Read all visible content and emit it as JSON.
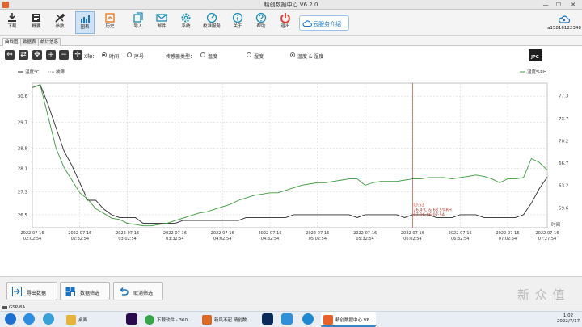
{
  "window": {
    "title": "精创数据中心 V6.2.0",
    "minimize": "—",
    "maximize": "☐",
    "close": "✕"
  },
  "toolbar": {
    "items": [
      {
        "label": "下载"
      },
      {
        "label": "概要"
      },
      {
        "label": "参数"
      },
      {
        "label": "图表"
      },
      {
        "label": "历史"
      },
      {
        "label": "导入"
      },
      {
        "label": "邮件"
      },
      {
        "label": "系统"
      },
      {
        "label": "校准服务"
      },
      {
        "label": "关于"
      },
      {
        "label": "帮助"
      },
      {
        "label": "退出"
      }
    ],
    "cloud_label": "云服务介绍",
    "account_label": "a15816122348"
  },
  "subtabs": [
    {
      "label": "曲线图"
    },
    {
      "label": "数据表"
    },
    {
      "label": "统计信息"
    }
  ],
  "controls": {
    "x_axis_label": "X轴：",
    "x_axis_options": [
      {
        "label": "时间",
        "checked": true
      },
      {
        "label": "序号",
        "checked": false
      }
    ],
    "sensor_label": "传感器类型：",
    "sensor_options": [
      {
        "label": "温度",
        "checked": false
      },
      {
        "label": "湿度",
        "checked": false
      },
      {
        "label": "温度 & 湿度",
        "checked": true
      }
    ],
    "export_jpg": "JPG"
  },
  "chart_data": {
    "type": "line",
    "legend": {
      "left": [
        "温度°C",
        "故障"
      ],
      "right": [
        "湿度%RH"
      ]
    },
    "x_label": "时间",
    "x_ticks": [
      "2022-07-16\n02:02:54",
      "2022-07-16\n02:32:54",
      "2022-07-16\n03:02:54",
      "2022-07-16\n03:32:54",
      "2022-07-16\n04:02:54",
      "2022-07-16\n04:32:54",
      "2022-07-16\n05:02:54",
      "2022-07-16\n05:32:54",
      "2022-07-16\n06:02:54",
      "2022-07-16\n06:32:54",
      "2022-07-16\n07:02:54",
      "2022-07-16\n07:27:54"
    ],
    "y_left": {
      "ticks": [
        "30.6",
        "29.7",
        "28.8",
        "28.1",
        "27.3",
        "26.5"
      ],
      "values": [
        30.6,
        29.7,
        28.8,
        28.1,
        27.3,
        26.5
      ]
    },
    "y_right": {
      "ticks": [
        "77.3",
        "73.7",
        "70.2",
        "66.7",
        "63.2",
        "59.6"
      ],
      "values": [
        77.3,
        73.7,
        70.2,
        66.7,
        63.2,
        59.6
      ]
    },
    "x_minutes": [
      0,
      5,
      10,
      15,
      20,
      25,
      30,
      35,
      40,
      45,
      50,
      55,
      60,
      65,
      70,
      75,
      80,
      85,
      90,
      95,
      100,
      105,
      110,
      115,
      120,
      125,
      130,
      135,
      140,
      145,
      150,
      155,
      160,
      165,
      170,
      175,
      180,
      185,
      190,
      195,
      200,
      205,
      210,
      215,
      220,
      225,
      230,
      235,
      240,
      245,
      250,
      255,
      260,
      265,
      270,
      275,
      280,
      285,
      290,
      295,
      300,
      305,
      310,
      315,
      320,
      325
    ],
    "series": [
      {
        "name": "温度°C",
        "color": "#2b2b2b",
        "values": [
          30.9,
          31.0,
          30.3,
          29.5,
          28.7,
          28.2,
          27.6,
          27.0,
          27.0,
          26.7,
          26.5,
          26.4,
          26.4,
          26.4,
          26.2,
          26.2,
          26.2,
          26.2,
          26.2,
          26.3,
          26.3,
          26.3,
          26.3,
          26.3,
          26.3,
          26.3,
          26.3,
          26.4,
          26.4,
          26.4,
          26.4,
          26.4,
          26.4,
          26.5,
          26.5,
          26.5,
          26.5,
          26.5,
          26.5,
          26.5,
          26.5,
          26.4,
          26.5,
          26.5,
          26.5,
          26.5,
          26.5,
          26.4,
          26.5,
          26.5,
          26.5,
          26.4,
          26.4,
          26.4,
          26.5,
          26.5,
          26.5,
          26.4,
          26.4,
          26.4,
          26.4,
          26.4,
          26.5,
          26.9,
          27.4,
          27.8
        ]
      },
      {
        "name": "湿度%RH",
        "color": "#3c9a3c",
        "values": [
          78.6,
          79.0,
          74.0,
          69.0,
          66.0,
          64.0,
          62.0,
          61.0,
          59.5,
          58.8,
          58.0,
          57.8,
          57.2,
          57.0,
          56.8,
          56.8,
          57.0,
          57.2,
          57.6,
          58.0,
          58.4,
          58.8,
          59.0,
          59.4,
          59.8,
          60.2,
          60.8,
          61.2,
          61.6,
          61.8,
          62.0,
          62.0,
          62.4,
          62.8,
          63.2,
          63.4,
          63.6,
          63.6,
          63.8,
          64.0,
          64.2,
          64.2,
          63.2,
          63.6,
          63.8,
          63.8,
          63.8,
          64.0,
          64.2,
          64.2,
          64.4,
          64.4,
          64.4,
          64.2,
          64.4,
          64.6,
          64.8,
          64.6,
          64.2,
          63.6,
          64.2,
          64.2,
          64.4,
          67.4,
          66.8,
          65.6
        ]
      }
    ],
    "cursor": {
      "x_minute": 240,
      "label_lines": [
        "ID:53",
        "26.4°C & 63.5%RH",
        "07-16 06:07:54"
      ],
      "color": "#c0392b"
    }
  },
  "bottom_buttons": [
    {
      "label": "导出数据"
    },
    {
      "label": "数据筛选"
    },
    {
      "label": "取消筛选"
    }
  ],
  "status": {
    "device": "GSP-8A"
  },
  "taskbar": {
    "apps": [
      {
        "label": "桌面"
      },
      {
        "label": "下载软件 - 360..."
      },
      {
        "label": "新风不起 精创数..."
      },
      {
        "label": "精创数据中心 V6..."
      }
    ],
    "time": "1:02",
    "date": "2022/7/17"
  },
  "watermark": "新 众 值"
}
